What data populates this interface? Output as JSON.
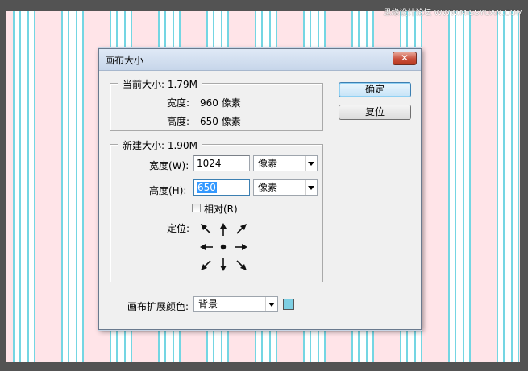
{
  "watermark": "思缘设计论坛 WWW.MISSYUAN.COM",
  "dialog": {
    "title": "画布大小",
    "close_icon": "close-icon",
    "ok_label": "确定",
    "reset_label": "复位"
  },
  "current_size": {
    "title": "当前大小: 1.79M",
    "width_label": "宽度:",
    "width_value": "960 像素",
    "height_label": "高度:",
    "height_value": "650 像素"
  },
  "new_size": {
    "title": "新建大小: 1.90M",
    "width_label": "宽度(W):",
    "width_value": "1024",
    "width_unit": "像素",
    "height_label": "高度(H):",
    "height_value": "650",
    "height_unit": "像素",
    "relative_label": "相对(R)",
    "relative_checked": false,
    "anchor_label": "定位:",
    "anchor_selected": "center"
  },
  "extension_color": {
    "label": "画布扩展颜色:",
    "value": "背景",
    "swatch_color": "#7ecfe3"
  }
}
